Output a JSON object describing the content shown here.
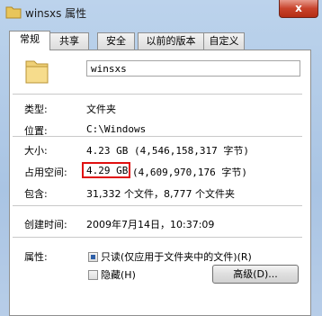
{
  "window": {
    "title": "winsxs 属性",
    "close_label": "x"
  },
  "tabs": [
    {
      "label": "常规",
      "active": true
    },
    {
      "label": "共享"
    },
    {
      "label": "安全"
    },
    {
      "label": "以前的版本"
    },
    {
      "label": "自定义"
    }
  ],
  "general": {
    "folder_name": "winsxs",
    "rows": [
      {
        "label": "类型:",
        "value": "文件夹"
      },
      {
        "label": "位置:",
        "value": "C:\\Windows"
      },
      {
        "label": "大小:",
        "value": "4.23 GB (4,546,158,317 字节)"
      },
      {
        "label": "占用空间:",
        "value_highlight": "4.29 GB",
        "value_rest": "(4,609,970,176 字节)"
      },
      {
        "label": "包含:",
        "value": "31,332 个文件，8,777 个文件夹"
      },
      {
        "label": "创建时间:",
        "value": "2009年7月14日，10:37:09"
      }
    ],
    "attributes": {
      "label": "属性:",
      "readonly_label": "只读(仅应用于文件夹中的文件)(R)",
      "hidden_label": "隐藏(H)",
      "advanced_label": "高级(D)..."
    }
  },
  "colors": {
    "highlight_border": "#e01010",
    "title_bar": "#b7cde8"
  }
}
